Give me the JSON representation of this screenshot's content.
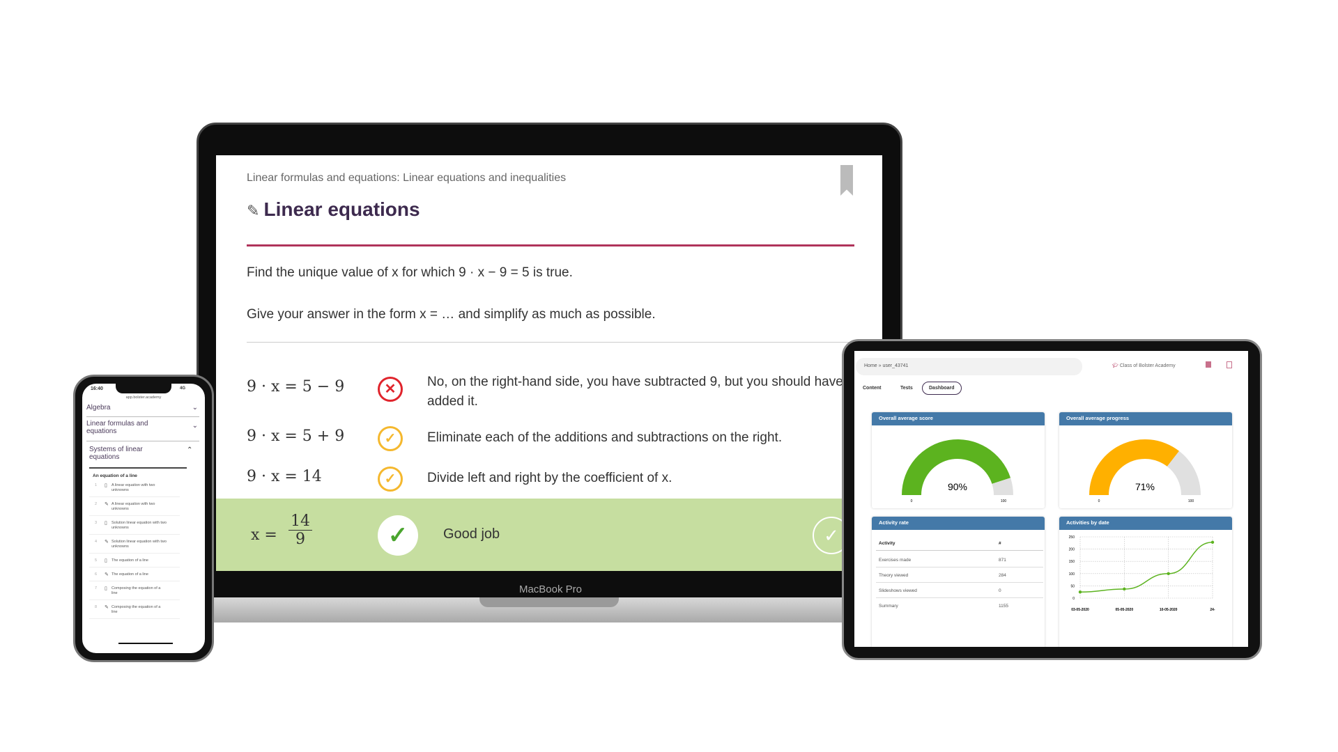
{
  "laptop": {
    "brand_label": "MacBook Pro",
    "breadcrumb": "Linear formulas and equations: Linear equations and inequalities",
    "title": "Linear equations",
    "question_line1": "Find the unique value of x for which 9 · x − 9 = 5 is true.",
    "question_line2": "Give your answer in the form x = … and simplify as much as possible.",
    "steps": [
      {
        "equation": "9 · x = 5 − 9",
        "status": "wrong",
        "feedback": "No, on the right-hand side, you have subtracted 9, but you should have added it."
      },
      {
        "equation": "9 · x = 5 + 9",
        "status": "ok",
        "feedback": "Eliminate each of the additions and subtractions on the right."
      },
      {
        "equation": "9 · x = 14",
        "status": "ok",
        "feedback": "Divide left and right by the coefficient of x."
      }
    ],
    "result": {
      "lhs": "x =",
      "numerator": "14",
      "denominator": "9",
      "message": "Good job"
    },
    "colors": {
      "title": "#3d2a4e",
      "rule": "#b0335a",
      "wrong": "#e0242c",
      "ok": "#f5b82e",
      "result_bg": "#c6dea0",
      "check": "#4aa52e"
    }
  },
  "phone": {
    "time": "16:40",
    "signal": "4G",
    "url": "app.bolster.academy",
    "accordions": [
      "Algebra",
      "Linear formulas and equations",
      "Systems of linear equations"
    ],
    "section": "An equation of a line",
    "items": [
      {
        "num": "1",
        "icon": "document-icon",
        "label": "A linear equation with two unknowns"
      },
      {
        "num": "2",
        "icon": "pencil-icon",
        "label": "A linear equation with two unknowns"
      },
      {
        "num": "3",
        "icon": "document-icon",
        "label": "Solution linear equation with two unknowns"
      },
      {
        "num": "4",
        "icon": "pencil-icon",
        "label": "Solution linear equation with two unknowns"
      },
      {
        "num": "5",
        "icon": "document-icon",
        "label": "The equation of a line"
      },
      {
        "num": "6",
        "icon": "pencil-icon",
        "label": "The equation of a line"
      },
      {
        "num": "7",
        "icon": "document-icon",
        "label": "Composing the equation of a line"
      },
      {
        "num": "8",
        "icon": "pencil-icon",
        "label": "Composing the equation of a line"
      }
    ]
  },
  "tablet": {
    "breadcrumb": "Home » user_43741",
    "class_label": "Class of Bolster Academy",
    "tabs": [
      "Content",
      "Tests",
      "Dashboard"
    ],
    "active_tab": "Dashboard",
    "score_card": {
      "title": "Overall average score",
      "value": 90,
      "label": "90%",
      "min": "0",
      "max": "100",
      "color": "#5cb31f"
    },
    "progress_card": {
      "title": "Overall average progress",
      "value": 71,
      "label": "71%",
      "min": "0",
      "max": "100",
      "color": "#ffb000"
    },
    "activity_card": {
      "title": "Activity rate",
      "headers": [
        "Activity",
        "#"
      ],
      "rows": [
        [
          "Exercises made",
          "871"
        ],
        [
          "Theory viewed",
          "284"
        ],
        [
          "Slideshows viewed",
          "0"
        ],
        [
          "Summary",
          "1155"
        ]
      ]
    },
    "chart_card": {
      "title": "Activities by date"
    }
  },
  "chart_data": {
    "type": "line",
    "title": "Activities by date",
    "categories": [
      "03-05-2020",
      "05-05-2020",
      "10-05-2020",
      "24-"
    ],
    "values": [
      25,
      37,
      100,
      228
    ],
    "ylim": [
      0,
      250
    ],
    "yticks": [
      "0",
      "50",
      "100",
      "150",
      "200",
      "250"
    ],
    "grid": true,
    "color": "#5cb31f"
  }
}
